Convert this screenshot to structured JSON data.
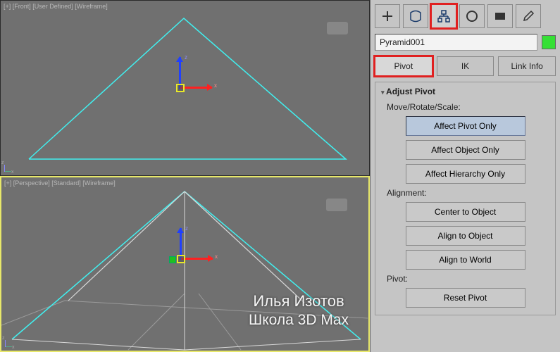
{
  "viewports": {
    "top": {
      "label": "[+] [Front] [User Defined] [Wireframe]"
    },
    "bottom": {
      "label": "[+] [Perspective] [Standard] [Wireframe]"
    },
    "axis_x": "x",
    "axis_z": "z"
  },
  "object_name": "Pyramid001",
  "object_color": "#35e035",
  "tabs": {
    "pivot": "Pivot",
    "ik": "IK",
    "link": "Link Info"
  },
  "rollout": {
    "title": "Adjust Pivot",
    "group_move": "Move/Rotate/Scale:",
    "btn_pivot_only": "Affect Pivot Only",
    "btn_object_only": "Affect Object Only",
    "btn_hierarchy_only": "Affect Hierarchy Only",
    "group_align": "Alignment:",
    "btn_center": "Center to Object",
    "btn_align_obj": "Align to Object",
    "btn_align_world": "Align to World",
    "group_pivot": "Pivot:",
    "btn_reset": "Reset Pivot"
  },
  "watermark": {
    "line1": "Илья Изотов",
    "line2": "Школа 3D Max"
  }
}
